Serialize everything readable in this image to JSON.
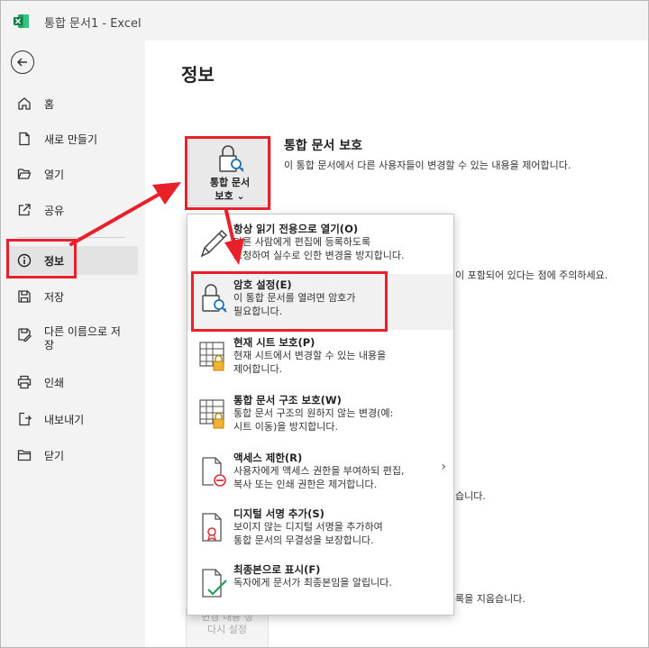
{
  "titlebar": {
    "doc_title": "통합 문서1  -  Excel"
  },
  "sidebar": {
    "items": [
      {
        "label": "홈",
        "icon": "home-icon"
      },
      {
        "label": "새로 만들기",
        "icon": "new-document-icon"
      },
      {
        "label": "열기",
        "icon": "folder-open-icon"
      },
      {
        "label": "공유",
        "icon": "share-icon"
      },
      {
        "label": "정보",
        "icon": "info-icon"
      },
      {
        "label": "저장",
        "icon": "save-icon"
      },
      {
        "label": "다른 이름으로 저장",
        "label_line1": "다른 이름으로 저",
        "label_line2": "장",
        "icon": "save-as-icon"
      },
      {
        "label": "인쇄",
        "icon": "print-icon"
      },
      {
        "label": "내보내기",
        "icon": "export-icon"
      },
      {
        "label": "닫기",
        "icon": "close-folder-icon"
      }
    ]
  },
  "main": {
    "page_title": "정보",
    "protect_section": {
      "button_line1": "통합 문서",
      "button_line2": "보호 ⌄",
      "title": "통합 문서 보호",
      "description": "이 통합 문서에서 다른 사용자들이 변경할 수 있는 내용을 제어합니다."
    },
    "partial_texts": {
      "inspect": "이 포함되어 있다는 점에 주의하세요.",
      "versions": "습니다.",
      "browser": "록을 지웁습니다."
    },
    "faded_button": {
      "line1": "변경 내용 정",
      "line2": "다시 설정"
    }
  },
  "menu": {
    "items": [
      {
        "title": "항상 읽기 전용으로 열기(O)",
        "desc1": "다른 사람에게 편집에 등록하도록",
        "desc2": "요청하여 실수로 인한 변경을 방지합니다.",
        "icon": "pencil-icon"
      },
      {
        "title": "암호 설정(E)",
        "desc1": "이 통합 문서를 열려면 암호가",
        "desc2": "필요합니다.",
        "icon": "lock-key-icon"
      },
      {
        "title": "현재 시트 보호(P)",
        "desc1": "현재 시트에서 변경할 수 있는 내용을",
        "desc2": "제어합니다.",
        "icon": "sheet-lock-icon"
      },
      {
        "title": "통합 문서 구조 보호(W)",
        "desc1": "통합 문서 구조의 원하지 않는 변경(예:",
        "desc2": "시트 이동)을 방지합니다.",
        "icon": "workbook-lock-icon"
      },
      {
        "title": "액세스 제한(R)",
        "desc1": "사용자에게 액세스 권한을 부여하되 편집,",
        "desc2": "복사 또는 인쇄 권한은 제거합니다.",
        "icon": "restrict-access-icon"
      },
      {
        "title": "디지털 서명 추가(S)",
        "desc1": "보이지 않는 디지털 서명을 추가하여",
        "desc2": "통합 문서의 무결성을 보장합니다.",
        "icon": "digital-signature-icon"
      },
      {
        "title": "최종본으로 표시(F)",
        "desc1": "독자에게 문서가 최종본임을 알립니다.",
        "desc2": "",
        "icon": "mark-final-icon"
      }
    ]
  },
  "colors": {
    "highlight_red": "#e8202a",
    "excel_green": "#107c41"
  }
}
